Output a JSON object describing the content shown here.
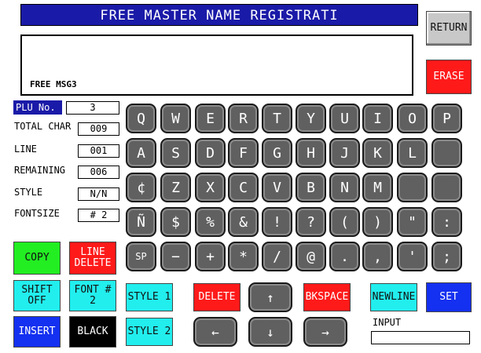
{
  "title": "FREE MASTER NAME REGISTRATI",
  "buttons": {
    "return": "RETURN",
    "erase": "ERASE",
    "copy": "COPY",
    "line_delete": "LINE DELETE",
    "shift_off": "SHIFT OFF",
    "font2": "FONT # 2",
    "style1": "STYLE 1",
    "style2": "STYLE 2",
    "delete": "DELETE",
    "bkspace": "BKSPACE",
    "newline": "NEWLINE",
    "set": "SET",
    "insert": "INSERT",
    "black": "BLACK"
  },
  "message": {
    "text": "FREE MSG3"
  },
  "info": {
    "plu_label": "PLU No.",
    "plu_value": "3",
    "total_label": "TOTAL CHAR",
    "total_value": "009",
    "line_label": "LINE",
    "line_value": "001",
    "remaining_label": "REMAINING",
    "remaining_value": "006",
    "style_label": "STYLE",
    "style_value": "N/N",
    "fontsize_label": "FONTSIZE",
    "fontsize_value": "# 2"
  },
  "keys": {
    "row1": [
      "Q",
      "W",
      "E",
      "R",
      "T",
      "Y",
      "U",
      "I",
      "O",
      "P"
    ],
    "row2": [
      "A",
      "S",
      "D",
      "F",
      "G",
      "H",
      "J",
      "K",
      "L",
      ""
    ],
    "row3": [
      "¢",
      "Z",
      "X",
      "C",
      "V",
      "B",
      "N",
      "M",
      "",
      ""
    ],
    "row4": [
      "Ñ",
      "$",
      "%",
      "&",
      "!",
      "?",
      "(",
      ")",
      "\"",
      ":"
    ],
    "row5": [
      "SP",
      "−",
      "+",
      "*",
      "/",
      "@",
      ".",
      ",",
      "'",
      ";"
    ]
  },
  "arrows": {
    "up": "↑",
    "left": "←",
    "down": "↓",
    "right": "→"
  },
  "input": {
    "label": "INPUT",
    "value": ""
  },
  "colors": {
    "title_bg": "#1a1aa8",
    "red": "#ff1a1a",
    "green": "#22ee22",
    "cyan": "#22eeee",
    "blue": "#1430f0",
    "key": "#606060"
  }
}
